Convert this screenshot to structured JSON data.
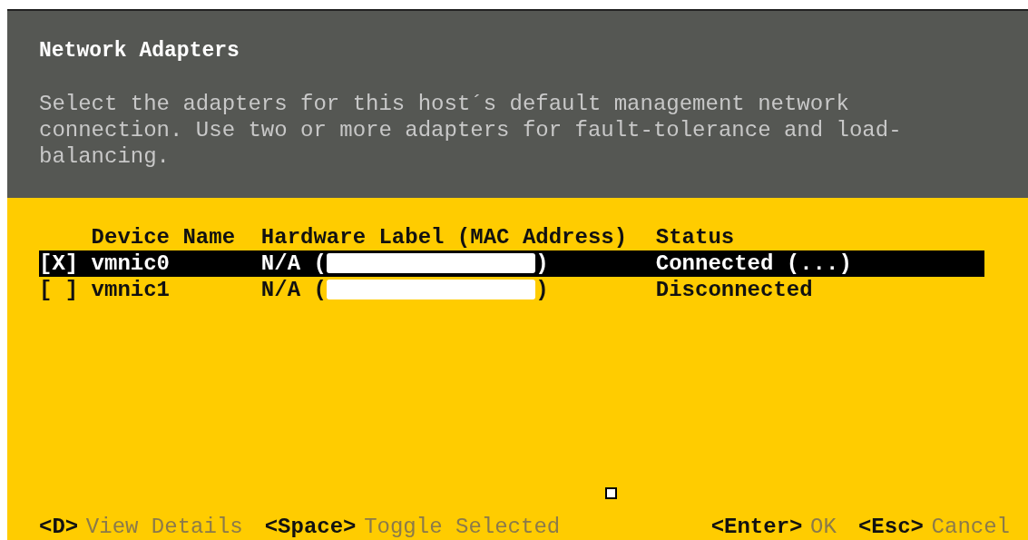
{
  "header": {
    "title": "Network Adapters",
    "description": "Select the adapters for this host´s default management network connection. Use two or more adapters for fault-tolerance and load-balancing."
  },
  "table": {
    "columns": [
      "Device Name",
      "Hardware Label (MAC Address)",
      "Status"
    ],
    "rows": [
      {
        "checkbox": "[X]",
        "device": "vmnic0",
        "hardware_prefix": "N/A (",
        "hardware_suffix": ")",
        "status": "Connected (...)",
        "selected": true
      },
      {
        "checkbox": "[ ]",
        "device": "vmnic1",
        "hardware_prefix": "N/A (",
        "hardware_suffix": ")",
        "status": "Disconnected",
        "selected": false
      }
    ]
  },
  "footer": {
    "left_hints": [
      {
        "key": "<D>",
        "label": "View Details"
      },
      {
        "key": "<Space>",
        "label": "Toggle Selected"
      }
    ],
    "right_hints": [
      {
        "key": "<Enter>",
        "label": "OK"
      },
      {
        "key": "<Esc>",
        "label": "Cancel"
      }
    ]
  }
}
